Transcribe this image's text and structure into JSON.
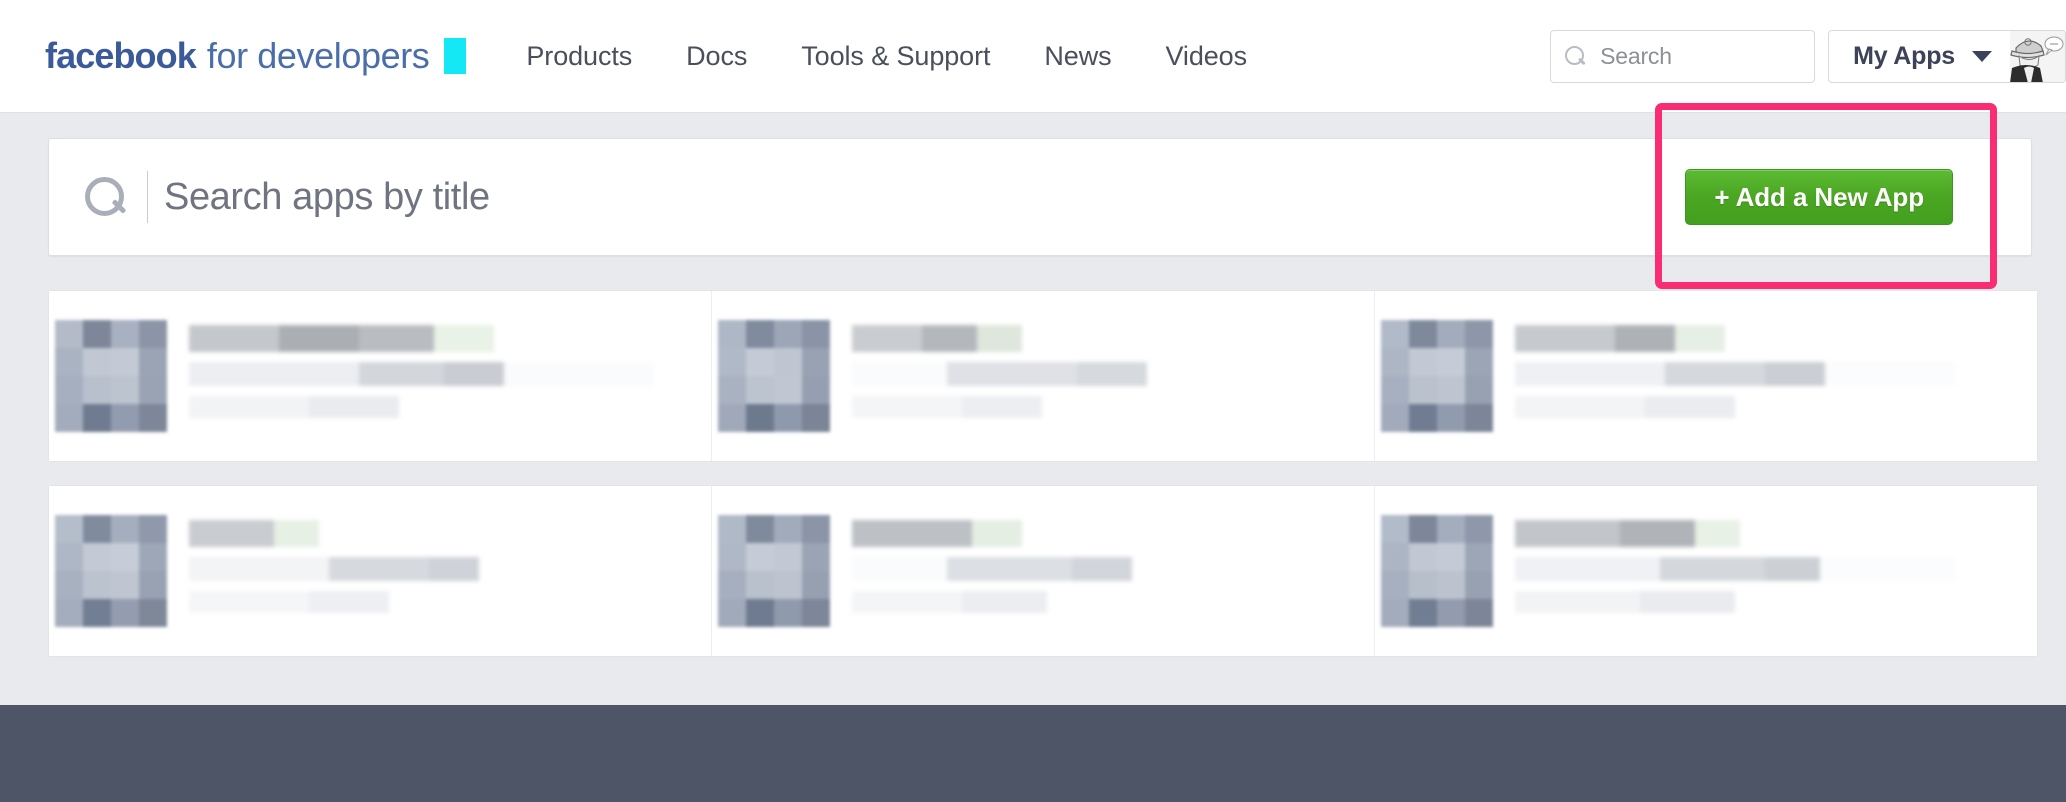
{
  "header": {
    "brand": {
      "bold": "facebook",
      "light": "for developers",
      "accent_color": "#14e8f5"
    },
    "nav": [
      {
        "label": "Products"
      },
      {
        "label": "Docs"
      },
      {
        "label": "Tools & Support"
      },
      {
        "label": "News"
      },
      {
        "label": "Videos"
      }
    ],
    "search": {
      "placeholder": "Search",
      "value": "",
      "icon": "search-icon"
    },
    "my_apps": {
      "label": "My Apps",
      "caret_icon": "chevron-down-icon",
      "avatar_icon": "user-avatar"
    }
  },
  "toolbar": {
    "search": {
      "placeholder": "Search apps by title",
      "value": "",
      "icon": "search-icon"
    },
    "add_app": {
      "label": "+ Add a New App",
      "plus_icon": "plus-icon",
      "color": "#4aa522",
      "border_color": "#3d9420"
    },
    "highlight": {
      "color": "#fa2d72",
      "target": "add-a-new-app-button"
    }
  },
  "apps": {
    "note": "app cards are pixelated / redacted in the screenshot",
    "rows": [
      {
        "cards": [
          {
            "name": "app-card-redacted"
          },
          {
            "name": "app-card-redacted"
          },
          {
            "name": "app-card-redacted"
          }
        ]
      },
      {
        "cards": [
          {
            "name": "app-card-redacted"
          },
          {
            "name": "app-card-redacted"
          },
          {
            "name": "app-card-redacted"
          }
        ]
      }
    ]
  },
  "footer": {
    "color": "#4e5566"
  },
  "colors": {
    "page_background": "#e8eaee",
    "panel_background": "#ffffff",
    "brand_blue": "#3a5a99",
    "nav_text": "#4b4f5c",
    "highlight_pink": "#fa2d72",
    "button_green": "#4aa522",
    "footer_slate": "#4e5566",
    "cyan_block": "#14e8f5"
  }
}
